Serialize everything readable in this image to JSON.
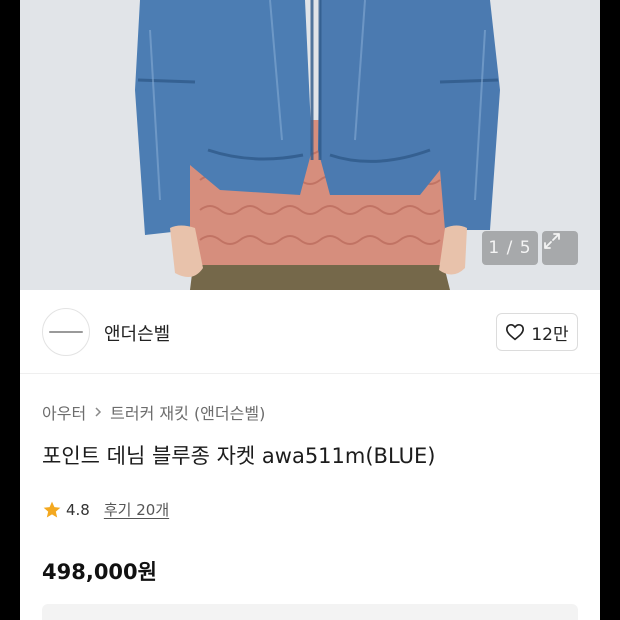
{
  "gallery": {
    "pager": "1 / 5",
    "expand_icon": "expand-icon"
  },
  "brand": {
    "name": "앤더슨벨",
    "like_count": "12만",
    "like_icon": "heart-outline-icon"
  },
  "product": {
    "breadcrumb": [
      "아우터",
      "트러커 재킷 (앤더슨벨)"
    ],
    "title": "포인트 데님 블루종 자켓 awa511m(BLUE)",
    "rating": "4.8",
    "review_link": "후기 20개",
    "price": "498,000원"
  },
  "colors": {
    "star": "#f3a81f",
    "denim": "#4a7bb1",
    "knit": "#d88f7e",
    "pants": "#7a6a48"
  }
}
